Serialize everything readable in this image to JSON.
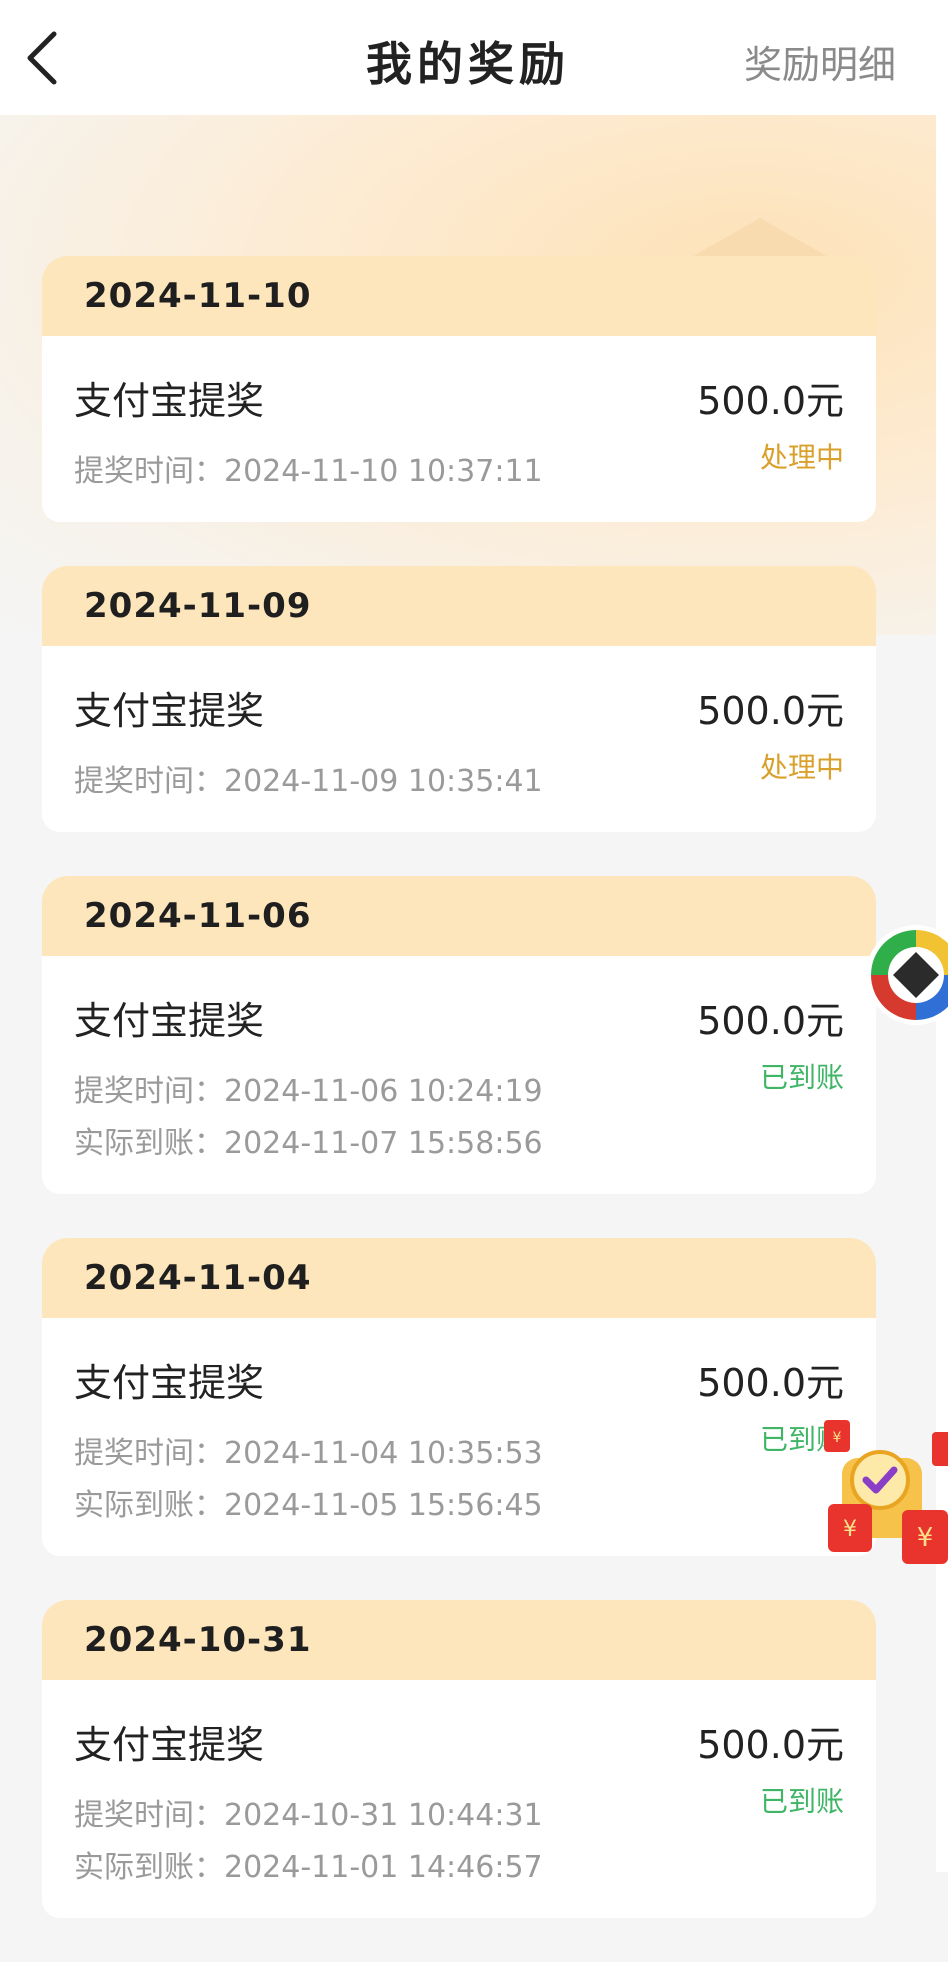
{
  "header": {
    "title": "我的奖励",
    "detail_link": "奖励明细"
  },
  "records": [
    {
      "date": "2024-11-10",
      "title": "支付宝提奖",
      "amount": "500.0元",
      "status": "处理中",
      "apply_time": "提奖时间：2024-11-10 10:37:11"
    },
    {
      "date": "2024-11-09",
      "title": "支付宝提奖",
      "amount": "500.0元",
      "status": "处理中",
      "apply_time": "提奖时间：2024-11-09 10:35:41"
    },
    {
      "date": "2024-11-06",
      "title": "支付宝提奖",
      "amount": "500.0元",
      "status": "已到账",
      "apply_time": "提奖时间：2024-11-06 10:24:19",
      "arrive_time": "实际到账：2024-11-07 15:58:56"
    },
    {
      "date": "2024-11-04",
      "title": "支付宝提奖",
      "amount": "500.0元",
      "status": "已到账",
      "apply_time": "提奖时间：2024-11-04 10:35:53",
      "arrive_time": "实际到账：2024-11-05 15:56:45"
    },
    {
      "date": "2024-10-31",
      "title": "支付宝提奖",
      "amount": "500.0元",
      "status": "已到账",
      "apply_time": "提奖时间：2024-10-31 10:44:31",
      "arrive_time": "实际到账：2024-11-01 14:46:57"
    }
  ],
  "colors": {
    "pending": "#d9a12c",
    "done": "#3fb566",
    "date_header_bg": "#fde6bc"
  },
  "icons": {
    "back": "chevron-left-icon",
    "floating_coin": "coin-icon",
    "floating_redpacket": "red-envelope-icon"
  }
}
